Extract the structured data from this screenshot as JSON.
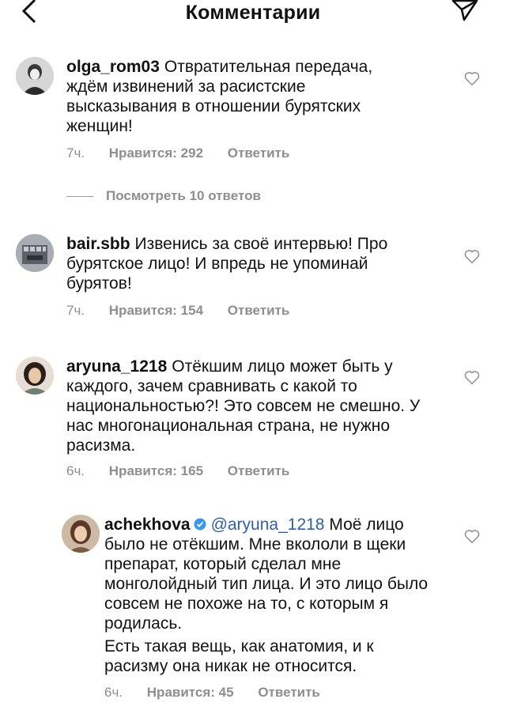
{
  "header": {
    "title": "Комментарии",
    "back_icon": "chevron-left-icon",
    "send_icon": "paper-plane-icon"
  },
  "comments": [
    {
      "username": "olga_rom03",
      "text": "Отвратительная передача, ждём извинений за расистские высказывания в отношении бурятских женщин!",
      "time": "7ч.",
      "likes": "Нравится: 292",
      "reply": "Ответить",
      "view_replies": "Посмотреть 10 ответов"
    },
    {
      "username": "bair.sbb",
      "text": "Извенись за своё интервью! Про бурятское лицо! И впредь не упоминай бурятов!",
      "time": "7ч.",
      "likes": "Нравится: 154",
      "reply": "Ответить"
    },
    {
      "username": "aryuna_1218",
      "text": "Отёкшим лицо может быть у каждого, зачем сравнивать с какой то национальностью?! Это совсем не смешно. У нас многонациональная страна, не нужно расизма.",
      "time": "6ч.",
      "likes": "Нравится: 165",
      "reply": "Ответить"
    },
    {
      "username": "achekhova",
      "mention": "@aryuna_1218",
      "text": "Моё лицо было не отёкшим. Мне вкололи в щеки препарат, который сделал мне монголойдный тип лица. И это лицо было совсем не похоже на то, с которым я родилась.",
      "text2": "Есть такая вещь, как анатомия, и к расизму она никак не относится.",
      "time": "6ч.",
      "likes": "Нравится: 45",
      "reply": "Ответить"
    }
  ],
  "colors": {
    "meta": "#8e8e8e",
    "mention": "#2f5fa6",
    "verified": "#3897f0"
  }
}
